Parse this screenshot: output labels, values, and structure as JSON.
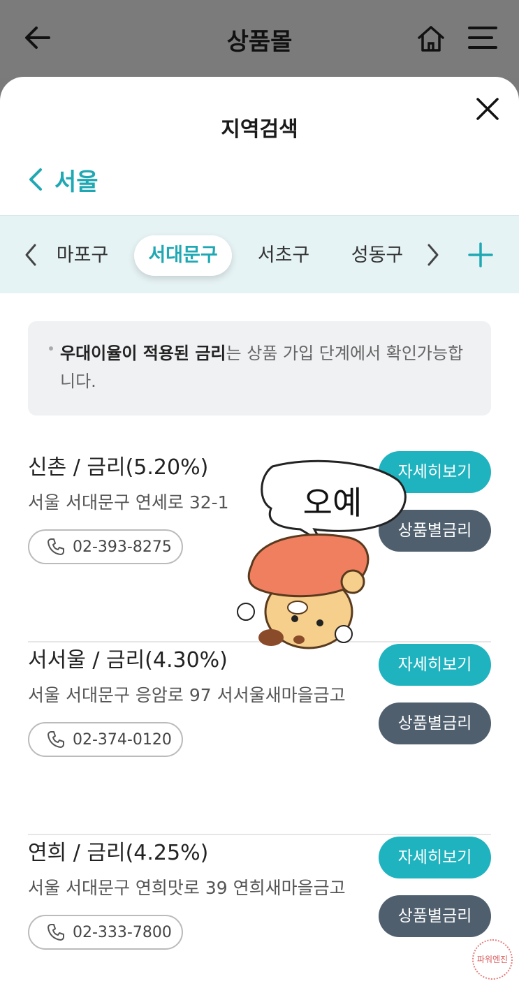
{
  "topbar": {
    "title": "상품몰"
  },
  "sheet": {
    "title": "지역검색",
    "city": "서울"
  },
  "tabs": [
    {
      "label": "마포구",
      "active": false
    },
    {
      "label": "서대문구",
      "active": true
    },
    {
      "label": "서초구",
      "active": false
    },
    {
      "label": "성동구",
      "active": false
    }
  ],
  "notice": {
    "bold": "우대이율이 적용된 금리",
    "rest": "는 상품 가입 단계에서 확인가능합니다."
  },
  "branches": [
    {
      "name": "신촌 / 금리(5.20%)",
      "address": "서울 서대문구 연세로 32-1",
      "phone": "02-393-8275"
    },
    {
      "name": "서서울 / 금리(4.30%)",
      "address": "서울 서대문구 응암로 97 서서울새마을금고",
      "phone": "02-374-0120"
    },
    {
      "name": "연희 / 금리(4.25%)",
      "address": "서울 서대문구 연희맛로 39 연희새마을금고",
      "phone": "02-333-7800"
    }
  ],
  "buttons": {
    "detail": "자세히보기",
    "rate": "상품별금리"
  },
  "sticker": {
    "text": "오예"
  },
  "stamp": {
    "text": "파워엔진"
  },
  "colors": {
    "accent": "#1fa8b3",
    "detail_button": "#1eb3bf",
    "rate_button": "#4f5f6e",
    "tab_bar": "#e6f3f4"
  }
}
